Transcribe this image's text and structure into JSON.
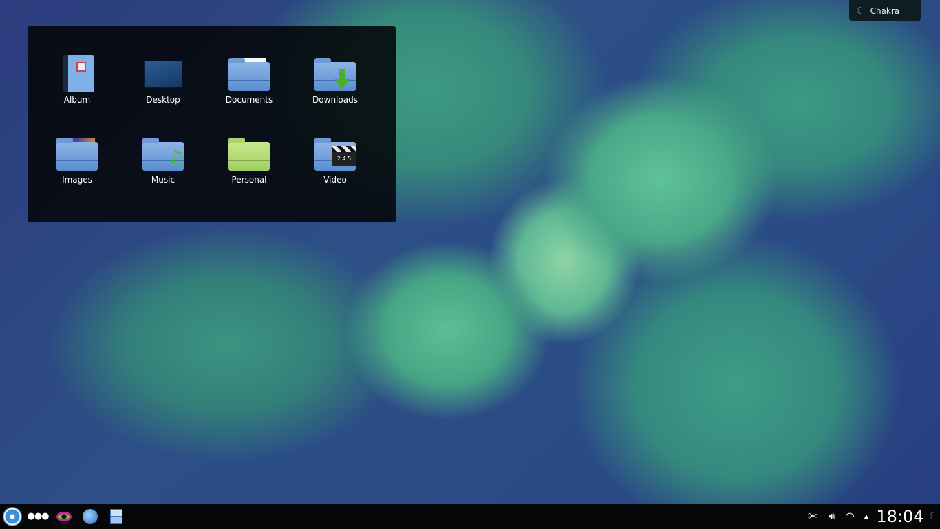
{
  "folderview": {
    "items": [
      {
        "label": "Album"
      },
      {
        "label": "Desktop"
      },
      {
        "label": "Documents"
      },
      {
        "label": "Downloads"
      },
      {
        "label": "Images"
      },
      {
        "label": "Music"
      },
      {
        "label": "Personal"
      },
      {
        "label": "Video"
      }
    ]
  },
  "activity": {
    "label": "Chakra"
  },
  "taskbar": {
    "clock": "18:04",
    "dots": "●●●"
  },
  "clapper": "2 4 5"
}
